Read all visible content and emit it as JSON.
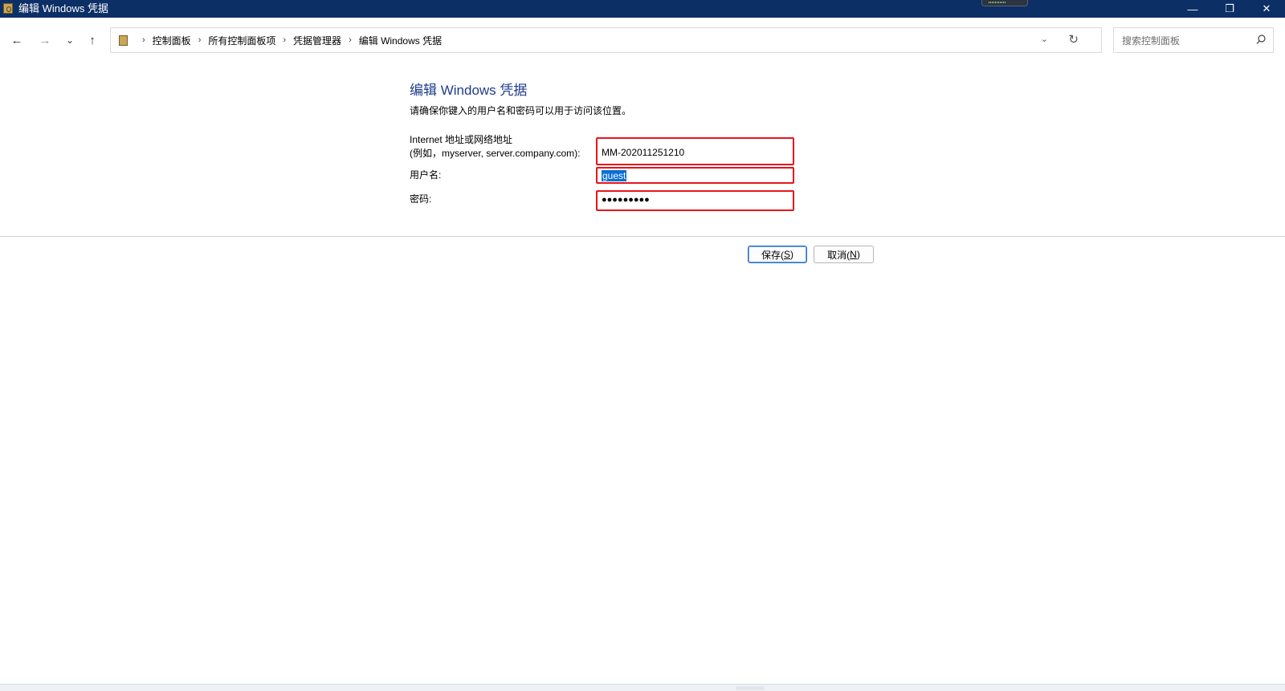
{
  "window": {
    "title": "编辑 Windows 凭据",
    "minimize_glyph": "—",
    "restore_glyph": "❐",
    "close_glyph": "✕"
  },
  "nav": {
    "back_glyph": "←",
    "forward_glyph": "→",
    "recent_glyph": "⌄",
    "up_glyph": "↑"
  },
  "breadcrumb": {
    "icon": "control-panel-icon",
    "separator": "›",
    "items": [
      "控制面板",
      "所有控制面板项",
      "凭据管理器",
      "编辑 Windows 凭据"
    ],
    "dropdown_glyph": "⌄",
    "refresh_glyph": "↻"
  },
  "search": {
    "placeholder": "搜索控制面板",
    "icon": "search-icon"
  },
  "form": {
    "heading": "编辑 Windows 凭据",
    "subtitle": "请确保你键入的用户名和密码可以用于访问该位置。",
    "address_label_line1": "Internet 地址或网络地址",
    "address_label_line2": "(例如，myserver, server.company.com):",
    "address_value": "MM-202011251210",
    "username_label": "用户名:",
    "username_value": "guest",
    "password_label": "密码:",
    "password_value": "●●●●●●●●●"
  },
  "buttons": {
    "save_label": "保存(S)",
    "save_mnemonic": "S",
    "cancel_label": "取消(N)",
    "cancel_mnemonic": "N"
  },
  "colors": {
    "titlebar": "#0c2f66",
    "heading": "#1e3c8c",
    "highlight_border": "#e8141c",
    "selection": "#0a6fd6"
  }
}
